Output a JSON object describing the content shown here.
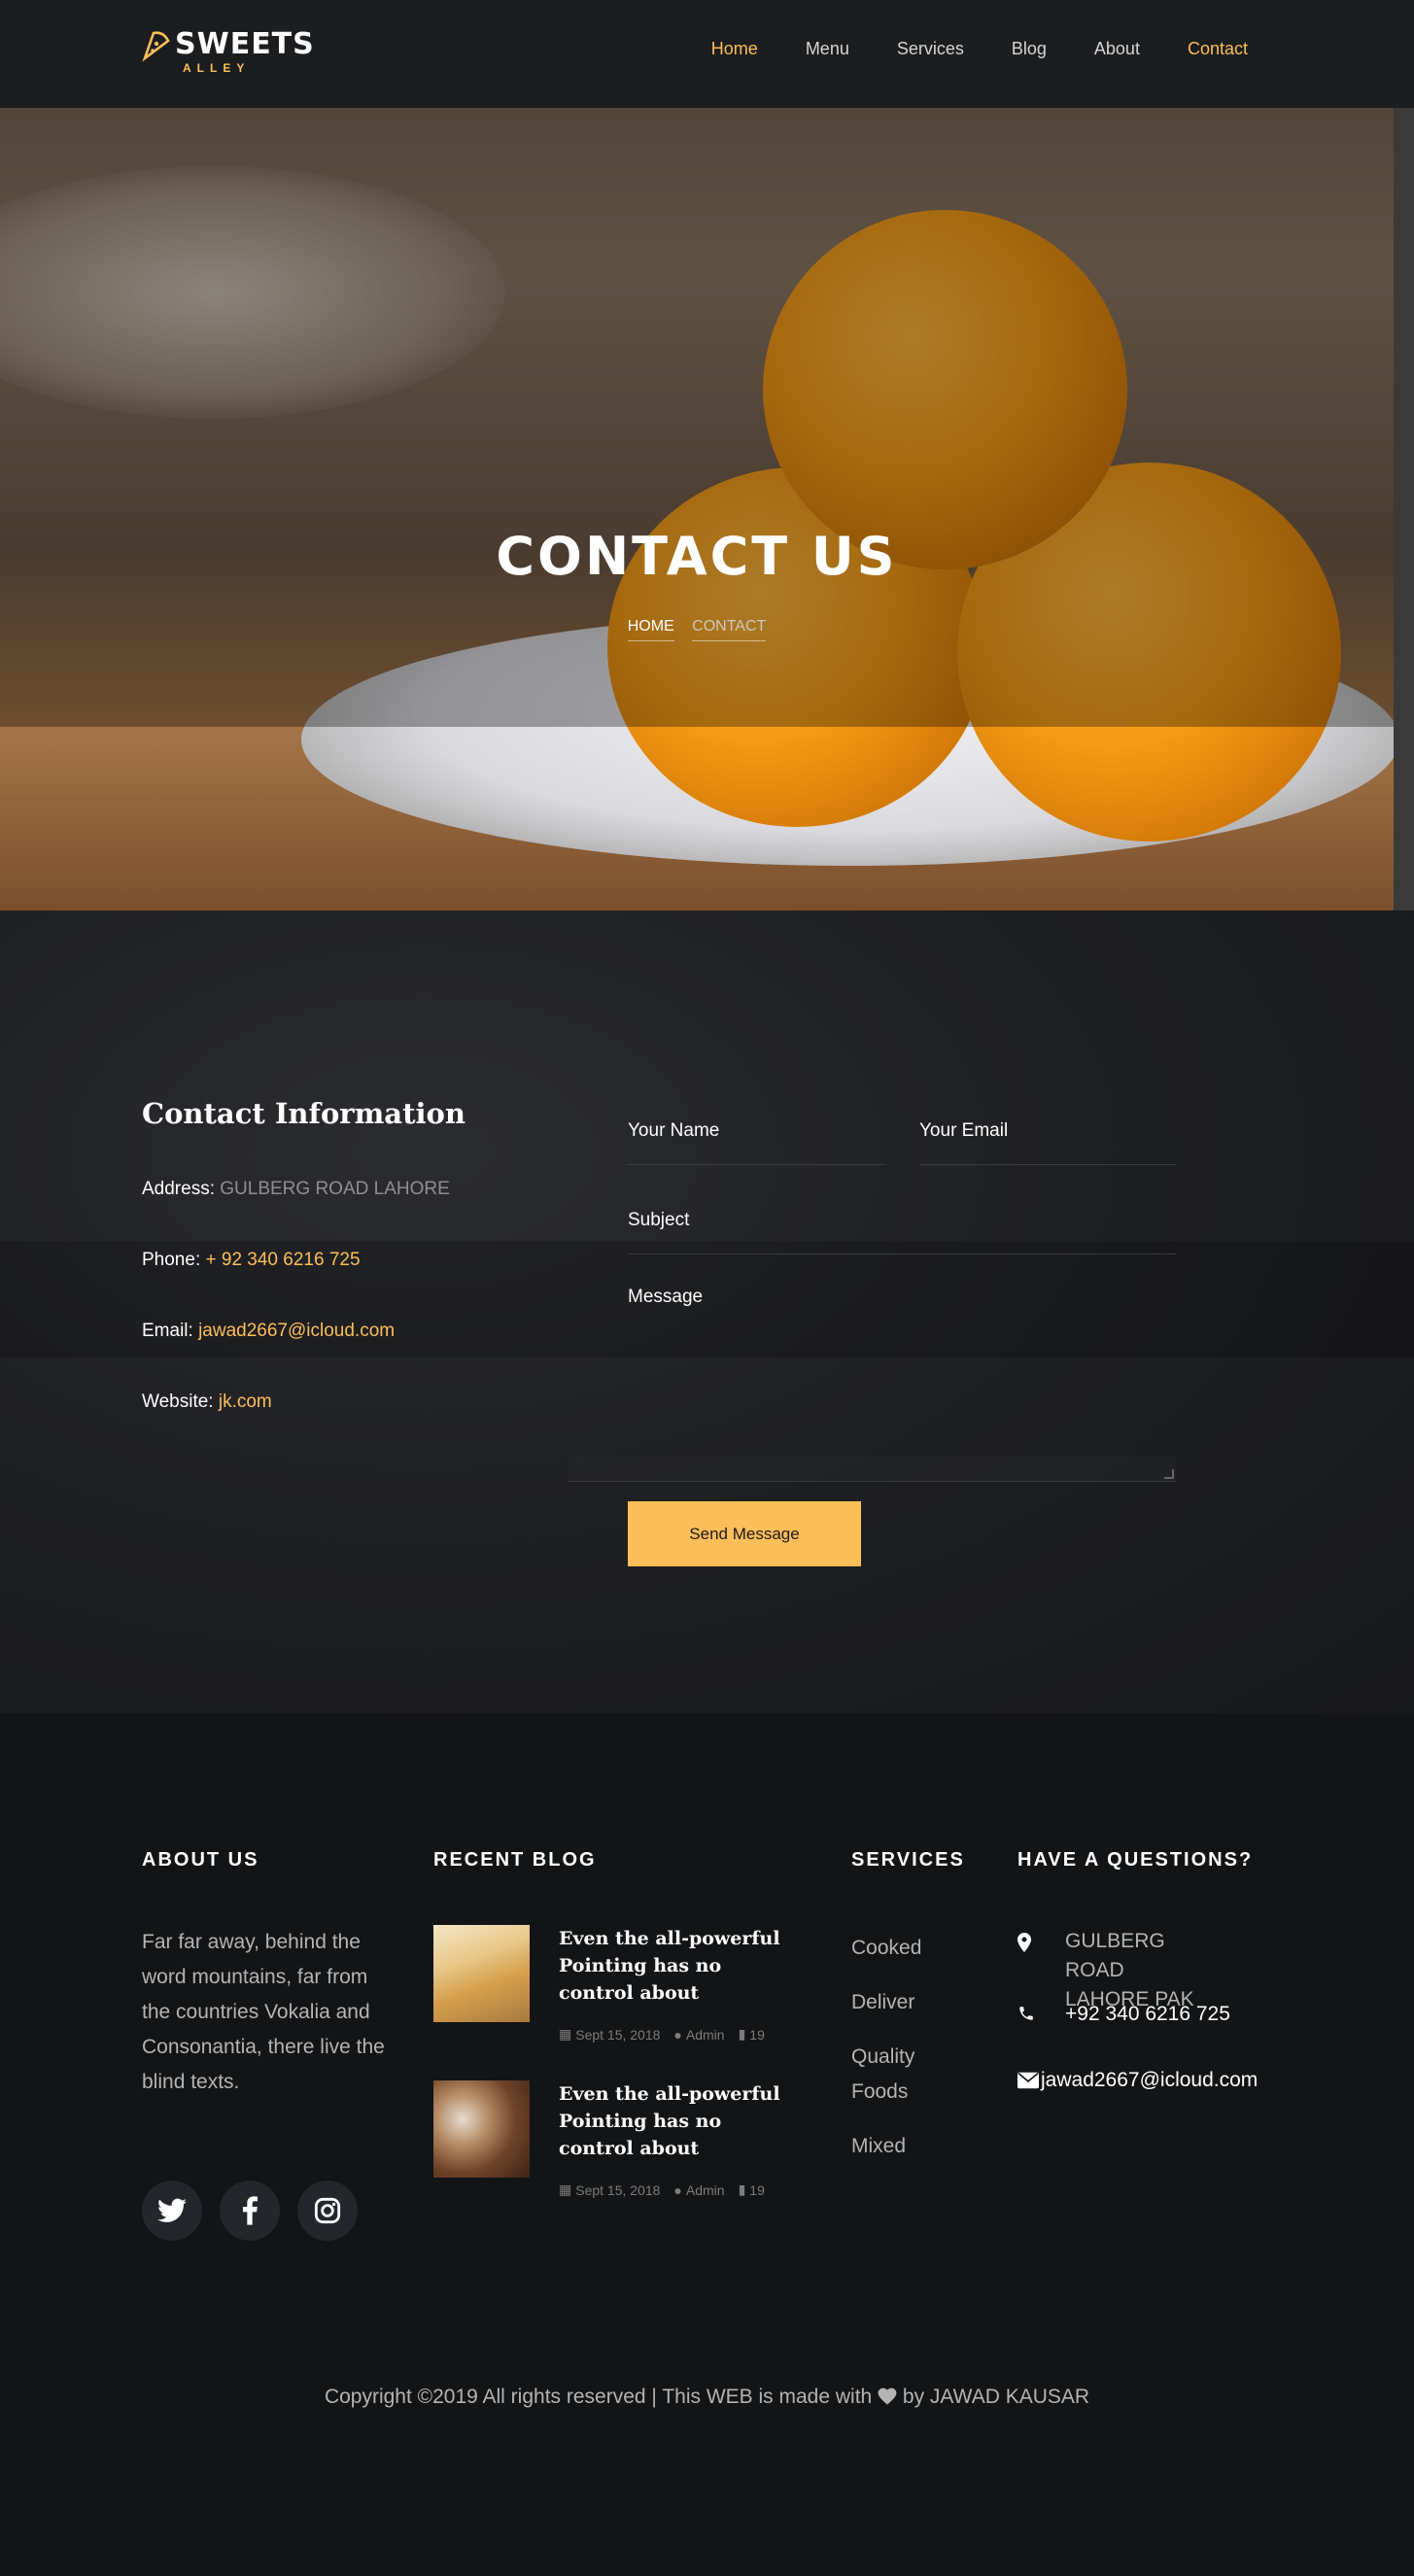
{
  "brand": {
    "name": "SWEETS",
    "tagline": "ALLEY",
    "accent": "#fdbe5a"
  },
  "nav": {
    "items": [
      {
        "label": "Home",
        "active": true
      },
      {
        "label": "Menu",
        "active": false
      },
      {
        "label": "Services",
        "active": false
      },
      {
        "label": "Blog",
        "active": false
      },
      {
        "label": "About",
        "active": false
      },
      {
        "label": "Contact",
        "active": true
      }
    ]
  },
  "hero": {
    "title": "CONTACT US",
    "breadcrumb": {
      "home": "HOME",
      "current": "CONTACT"
    }
  },
  "contact_info": {
    "title": "Contact Information",
    "address_label": "Address:",
    "address_value": "GULBERG ROAD LAHORE",
    "phone_label": "Phone:",
    "phone_value": "+ 92 340 6216 725",
    "email_label": "Email:",
    "email_value": "jawad2667@icloud.com",
    "website_label": "Website:",
    "website_value": "jk.com"
  },
  "form": {
    "name_placeholder": "Your Name",
    "email_placeholder": "Your Email",
    "subject_placeholder": "Subject",
    "message_placeholder": "Message",
    "submit_label": "Send Message"
  },
  "footer": {
    "about": {
      "heading": "ABOUT US",
      "text": "Far far away, behind the word mountains, far from the countries Vokalia and Consonantia, there live the blind texts.",
      "social": [
        "twitter-icon",
        "facebook-icon",
        "instagram-icon"
      ]
    },
    "blog": {
      "heading": "RECENT BLOG",
      "posts": [
        {
          "title": "Even the all-powerful Pointing has no control about",
          "date": "Sept 15, 2018",
          "author": "Admin",
          "comments": "19"
        },
        {
          "title": "Even the all-powerful Pointing has no control about",
          "date": "Sept 15, 2018",
          "author": "Admin",
          "comments": "19"
        }
      ]
    },
    "services": {
      "heading": "SERVICES",
      "items": [
        "Cooked",
        "Deliver",
        "Quality Foods",
        "Mixed"
      ]
    },
    "questions": {
      "heading": "HAVE A QUESTIONS?",
      "address": "GULBERG ROAD LAHORE PAK",
      "phone": "+92 340 6216 725",
      "email": "jawad2667@icloud.com"
    },
    "copyright_pre": "Copyright ©2019 All rights reserved | This WEB is made with",
    "copyright_post": "by JAWAD KAUSAR"
  }
}
